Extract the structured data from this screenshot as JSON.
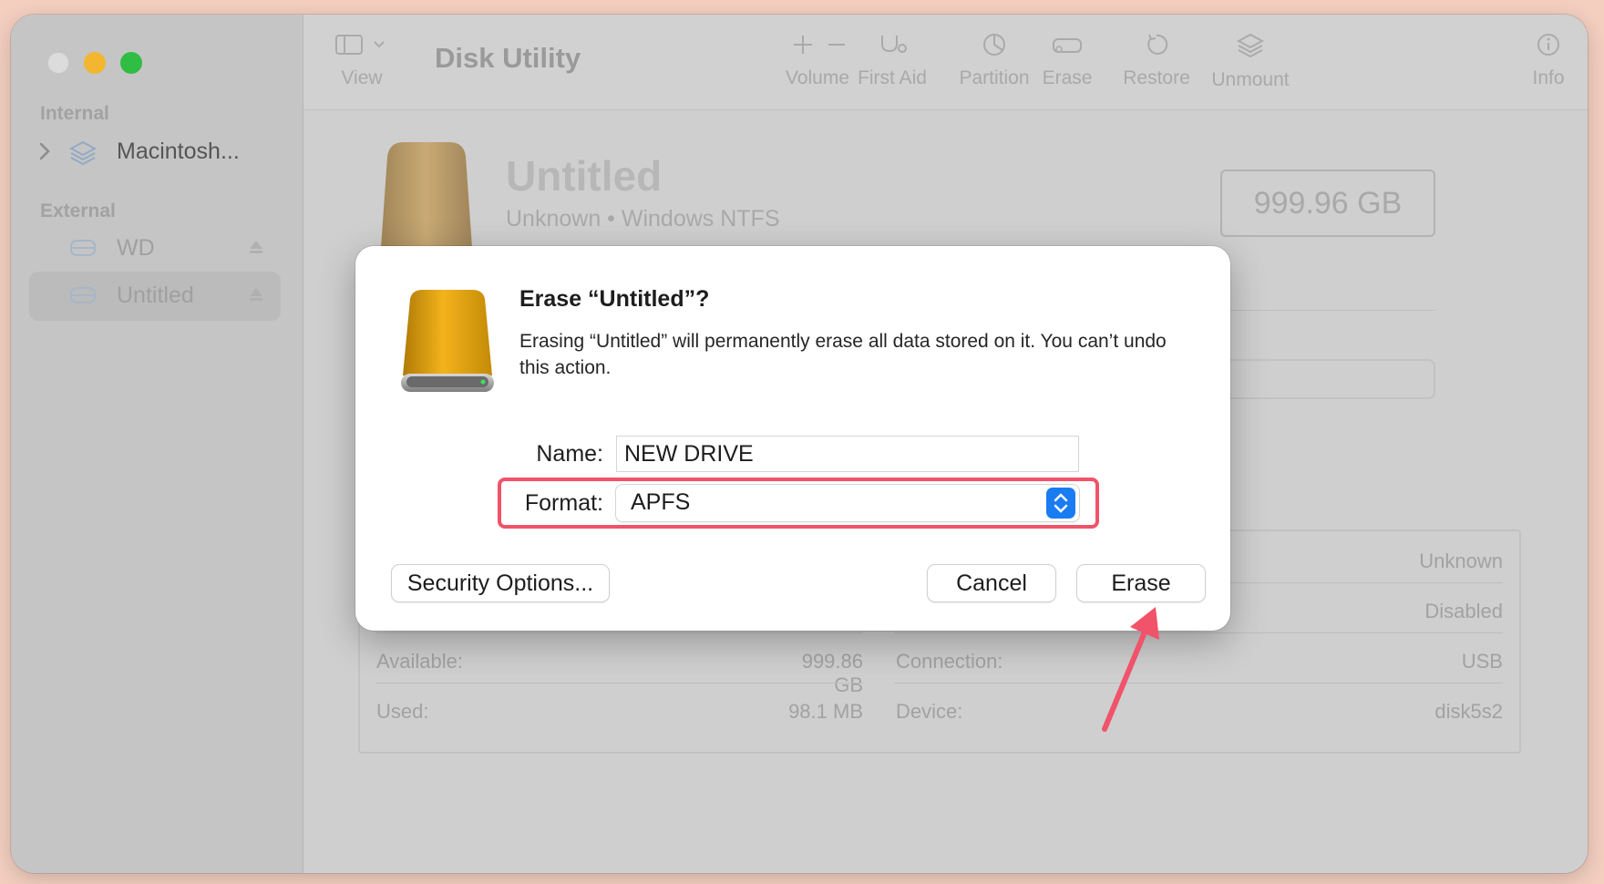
{
  "window": {
    "title": "Disk Utility"
  },
  "sidebar": {
    "sections": [
      {
        "label": "Internal",
        "items": [
          {
            "label": "Macintosh..."
          }
        ]
      },
      {
        "label": "External",
        "items": [
          {
            "label": "WD"
          },
          {
            "label": "Untitled"
          }
        ]
      }
    ]
  },
  "toolbar": {
    "view_label": "View",
    "buttons": [
      {
        "label": "Volume"
      },
      {
        "label": "First Aid"
      },
      {
        "label": "Partition"
      },
      {
        "label": "Erase"
      },
      {
        "label": "Restore"
      },
      {
        "label": "Unmount"
      },
      {
        "label": "Info"
      }
    ]
  },
  "disk": {
    "name": "Untitled",
    "subtitle": "Unknown • Windows NTFS",
    "capacity": "999.96 GB"
  },
  "info": {
    "right_values": [
      "Unknown",
      "Disabled"
    ],
    "rows": [
      {
        "left_label": "Available:",
        "left_value": "999.86 GB",
        "right_label": "Connection:",
        "right_value": "USB"
      },
      {
        "left_label": "Used:",
        "left_value": "98.1 MB",
        "right_label": "Device:",
        "right_value": "disk5s2"
      }
    ]
  },
  "dialog": {
    "title": "Erase “Untitled”?",
    "message": "Erasing “Untitled” will permanently erase all data stored on it. You can’t undo this action.",
    "name_label": "Name:",
    "name_value": "NEW DRIVE",
    "format_label": "Format:",
    "format_value": "APFS",
    "security_button": "Security Options...",
    "cancel_button": "Cancel",
    "erase_button": "Erase"
  },
  "colors": {
    "highlight": "#f0536a",
    "accent": "#1a7cf2"
  }
}
